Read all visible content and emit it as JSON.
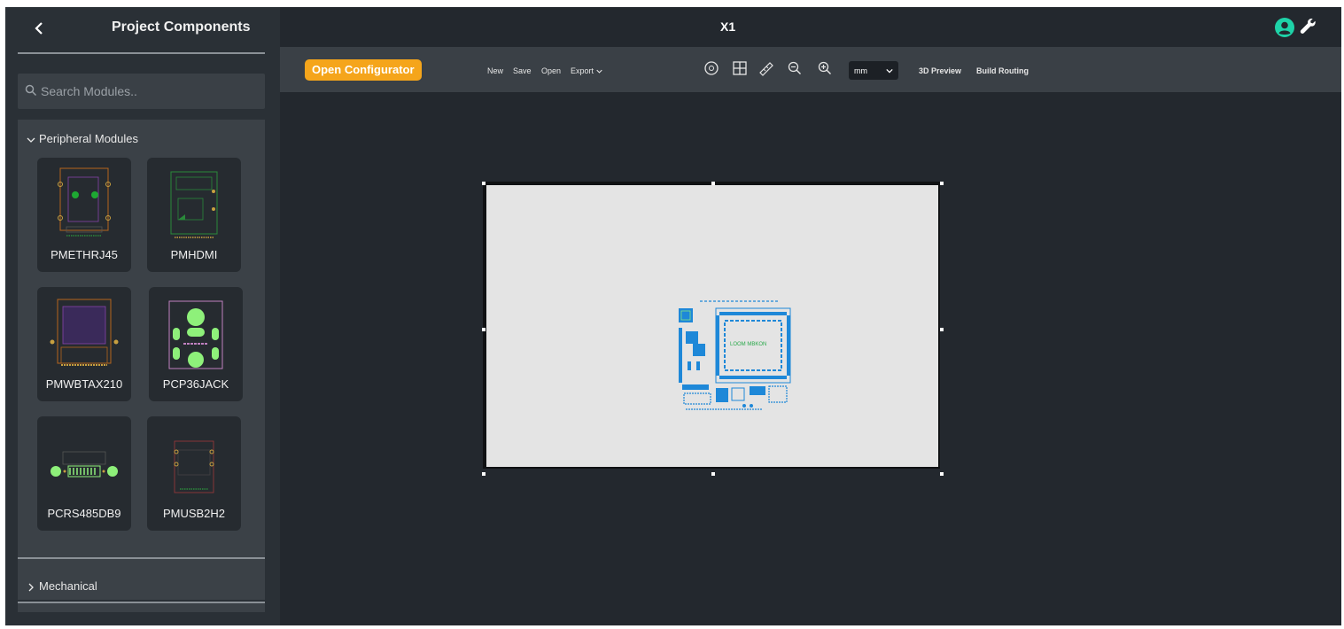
{
  "sidebar": {
    "title": "Project Components",
    "back_icon": "chevron-left-icon",
    "search": {
      "placeholder": "Search Modules.."
    },
    "groups": [
      {
        "label": "Peripheral Modules",
        "expanded": true
      },
      {
        "label": "Mechanical",
        "expanded": false
      }
    ],
    "modules": [
      {
        "label": "PMETHRJ45"
      },
      {
        "label": "PMHDMI"
      },
      {
        "label": "PMWBTAX210"
      },
      {
        "label": "PCP36JACK"
      },
      {
        "label": "PCRS485DB9"
      },
      {
        "label": "PMUSB2H2"
      }
    ]
  },
  "topbar": {
    "title": "X1",
    "user_icon": "user-circle-icon",
    "settings_icon": "wrench-icon",
    "user_icon_color": "#1ed3a8"
  },
  "toolbar": {
    "open_configurator": "Open Configurator",
    "accent": "#f5a51b",
    "file_actions": {
      "new": "New",
      "save": "Save",
      "open": "Open",
      "export": "Export"
    },
    "tools": [
      "target-icon",
      "grid-icon",
      "ruler-icon",
      "zoom-out-icon",
      "zoom-in-icon"
    ],
    "unit": "mm",
    "preview": "3D Preview",
    "routing": "Build Routing"
  },
  "canvas": {
    "board_color": "#e4e4e4"
  }
}
